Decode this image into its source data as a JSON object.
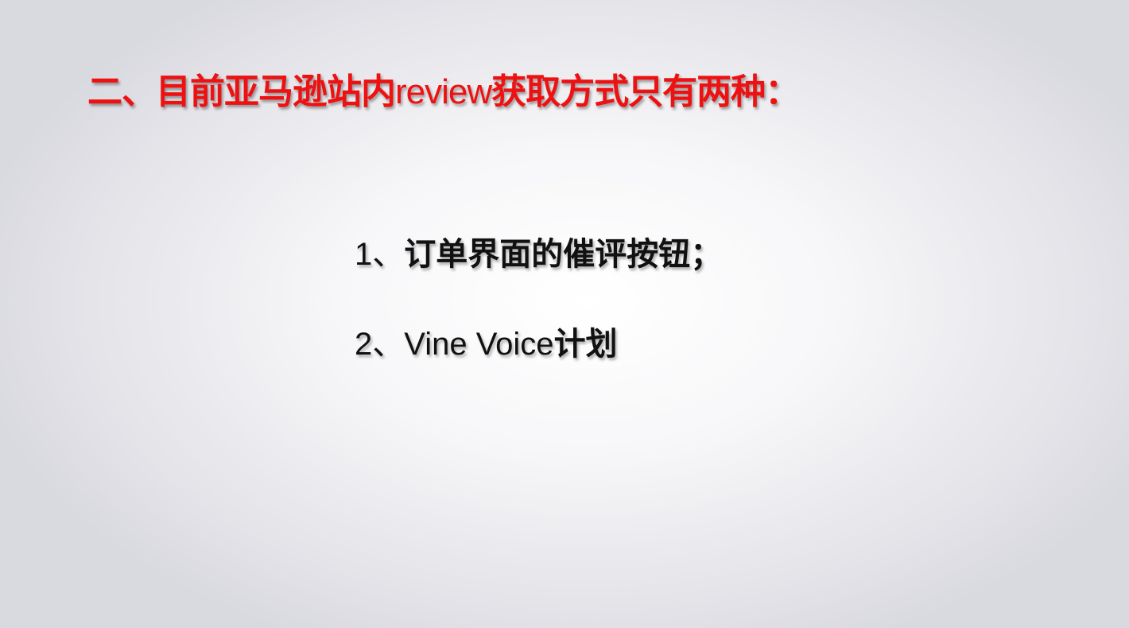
{
  "slide": {
    "title": {
      "part1": "二、目前亚马逊站内",
      "part2": "review",
      "part3": "获取方式只有两种："
    },
    "items": [
      {
        "number": "1、",
        "text_normal": "",
        "text_bold": "订单界面的催评按钮；"
      },
      {
        "number": "2、",
        "text_normal": "Vine Voice",
        "text_bold": "计划"
      }
    ],
    "colors": {
      "title": "#ee1111",
      "body": "#111111"
    }
  }
}
